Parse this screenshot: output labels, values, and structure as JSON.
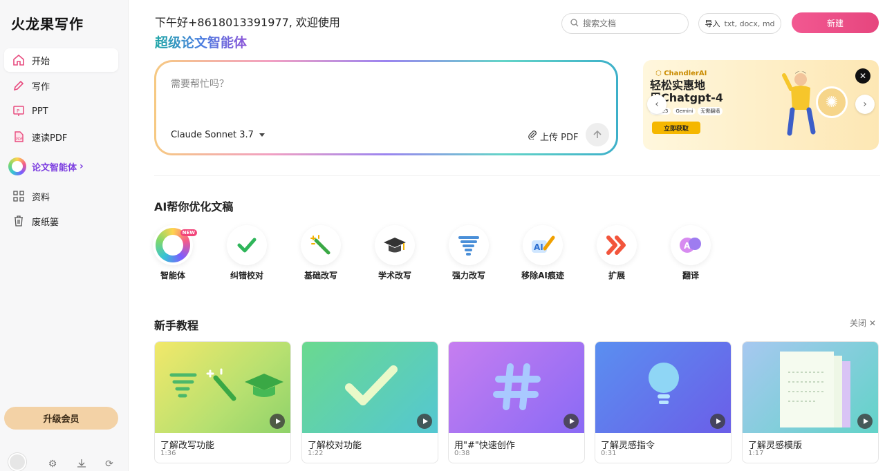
{
  "app": {
    "logo": "火龙果写作"
  },
  "sidebar": {
    "items": [
      {
        "label": "开始",
        "icon": "home-icon"
      },
      {
        "label": "写作",
        "icon": "pen-icon"
      },
      {
        "label": "PPT",
        "icon": "ppt-icon"
      },
      {
        "label": "速读PDF",
        "icon": "pdf-icon"
      },
      {
        "label": "论文智能体",
        "icon": "agent-ball-icon"
      },
      {
        "label": "资料",
        "icon": "grid-icon"
      },
      {
        "label": "废纸篓",
        "icon": "trash-icon"
      }
    ],
    "upgrade_label": "升级会员"
  },
  "header": {
    "greeting": "下午好+8618013391977, 欢迎使用",
    "brand_subtitle": "超级论文智能体",
    "search_placeholder": "搜索文档",
    "import_label": "导入",
    "import_hint": "txt, docx, md",
    "new_label": "新建"
  },
  "prompt": {
    "placeholder": "需要帮忙吗？",
    "model": "Claude Sonnet 3.7",
    "upload_label": "上传 PDF"
  },
  "banner": {
    "brand": "ChandlerAI",
    "title_line1": "轻松实惠地",
    "title_line2": "用Chatgpt-4",
    "chips": [
      "Dalle3",
      "Gemini",
      "无需翻墙"
    ],
    "cta": "立即获取"
  },
  "tools": {
    "title": "AI帮你优化文稿",
    "items": [
      {
        "label": "智能体",
        "badge": "NEW"
      },
      {
        "label": "纠错校对"
      },
      {
        "label": "基础改写"
      },
      {
        "label": "学术改写"
      },
      {
        "label": "强力改写"
      },
      {
        "label": "移除AI痕迹"
      },
      {
        "label": "扩展"
      },
      {
        "label": "翻译"
      }
    ]
  },
  "tutorials": {
    "title": "新手教程",
    "close_label": "关闭",
    "cards": [
      {
        "title": "了解改写功能",
        "duration": "1:36"
      },
      {
        "title": "了解校对功能",
        "duration": "1:22"
      },
      {
        "title": "用\"#\"快速创作",
        "duration": "0:38"
      },
      {
        "title": "了解灵感指令",
        "duration": "0:31"
      },
      {
        "title": "了解灵感模版",
        "duration": "1:17"
      }
    ]
  },
  "colors": {
    "accent_pink": "#e84a7e",
    "agent_purple": "#7d3fe0",
    "upgrade_bg": "#f3d2a6"
  }
}
